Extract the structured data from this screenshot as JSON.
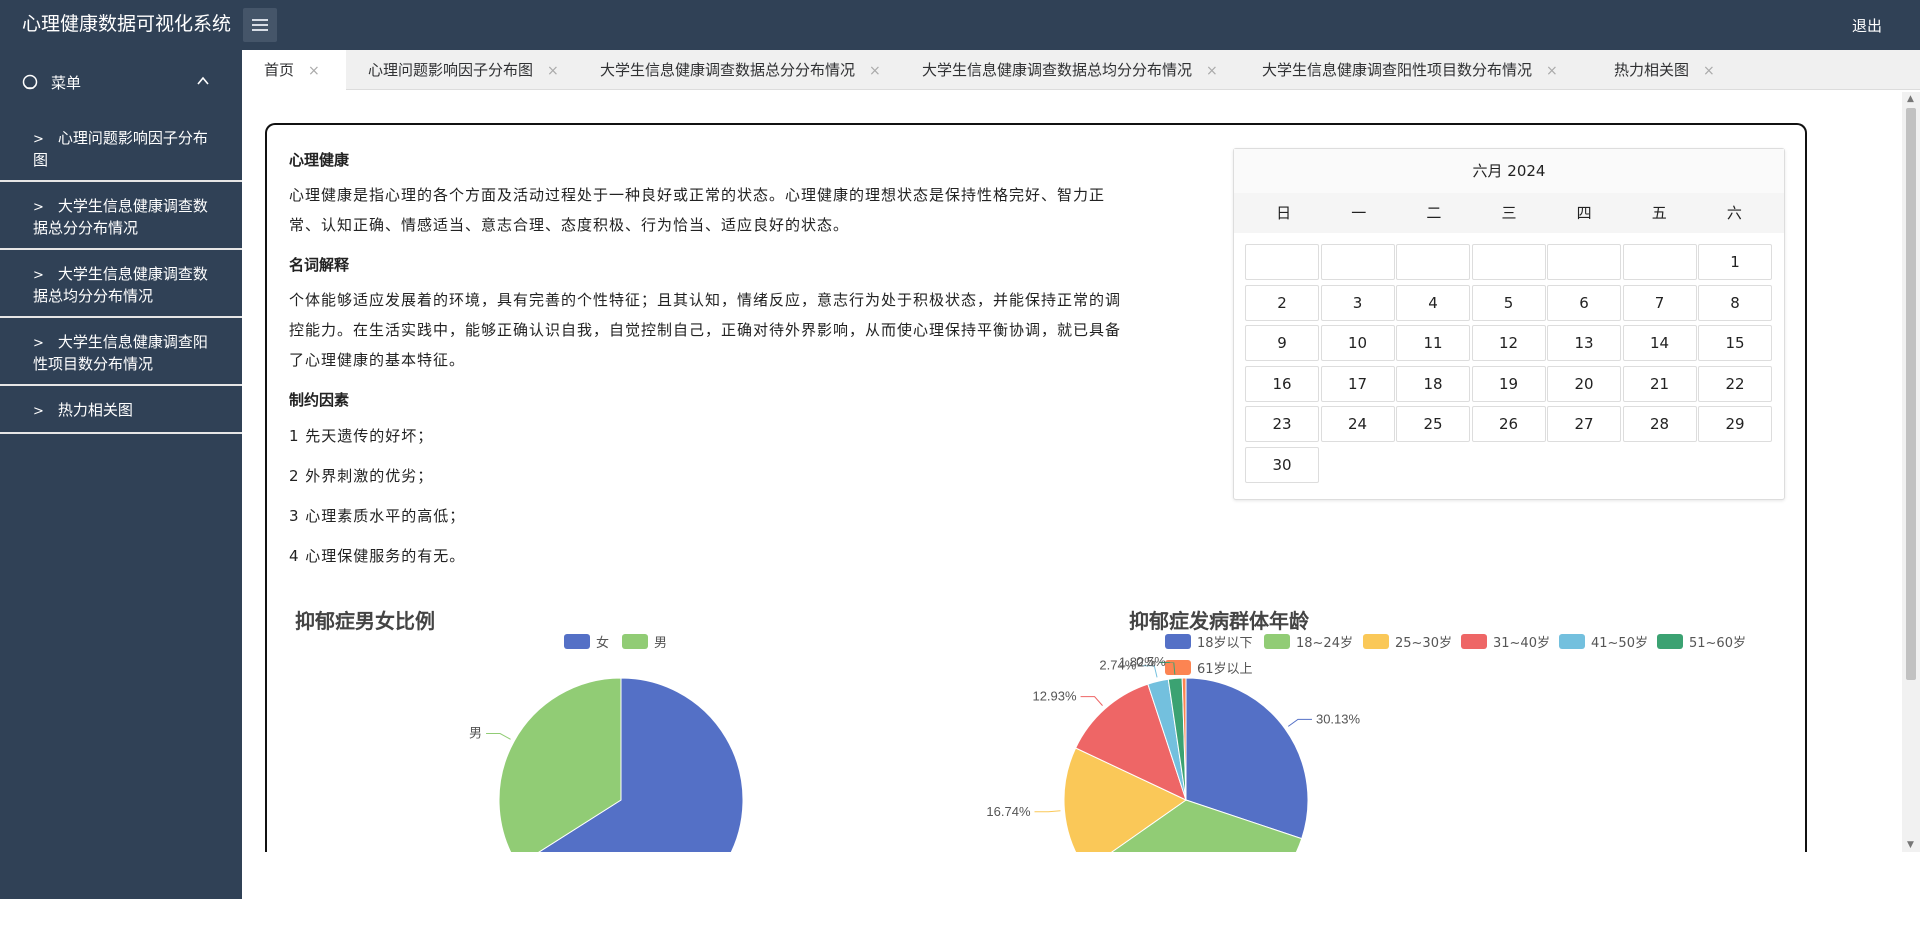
{
  "app": {
    "title": "心理健康数据可视化系统",
    "logout": "退出"
  },
  "sidebar": {
    "menu_label": "菜单",
    "items": [
      {
        "label": "心理问题影响因子分布图"
      },
      {
        "label": "大学生信息健康调查数据总分分布情况"
      },
      {
        "label": "大学生信息健康调查数据总均分分布情况"
      },
      {
        "label": "大学生信息健康调查阳性项目数分布情况"
      },
      {
        "label": "热力相关图"
      }
    ]
  },
  "tabs": [
    {
      "label": "首页"
    },
    {
      "label": "心理问题影响因子分布图"
    },
    {
      "label": "大学生信息健康调查数据总分分布情况"
    },
    {
      "label": "大学生信息健康调查数据总均分分布情况"
    },
    {
      "label": "大学生信息健康调查阳性项目数分布情况"
    },
    {
      "label": "热力相关图"
    }
  ],
  "tab_close": "×",
  "intro": {
    "h1": "心理健康",
    "p1": "心理健康是指心理的各个方面及活动过程处于一种良好或正常的状态。心理健康的理想状态是保持性格完好、智力正常、认知正确、情感适当、意志合理、态度积极、行为恰当、适应良好的状态。",
    "h2": "名词解释",
    "p2": "个体能够适应发展着的环境，具有完善的个性特征；且其认知，情绪反应，意志行为处于积极状态，并能保持正常的调控能力。在生活实践中，能够正确认识自我，自觉控制自己，正确对待外界影响，从而使心理保持平衡协调，就已具备了心理健康的基本特征。",
    "h3": "制约因素",
    "factors": [
      "1 先天遗传的好坏；",
      "2 外界刺激的优劣；",
      "3 心理素质水平的高低；",
      "4 心理保健服务的有无。"
    ]
  },
  "calendar": {
    "title": "六月 2024",
    "weekdays": [
      "日",
      "一",
      "二",
      "三",
      "四",
      "五",
      "六"
    ],
    "first_weekday": 6,
    "days": 30
  },
  "chart_data": [
    {
      "type": "pie",
      "title": "抑郁症男女比例",
      "series": [
        {
          "name": "女",
          "value": 66,
          "color": "#5470c6"
        },
        {
          "name": "男",
          "value": 34,
          "color": "#91cc75"
        }
      ],
      "legend_position": "top-center"
    },
    {
      "type": "pie",
      "title": "抑郁症发病群体年龄",
      "series": [
        {
          "name": "18岁以下",
          "value": 30.13,
          "label": "30.13%",
          "color": "#5470c6"
        },
        {
          "name": "18~24岁",
          "value": 35.14,
          "label": "",
          "color": "#91cc75"
        },
        {
          "name": "25~30岁",
          "value": 16.74,
          "label": "16.74%",
          "color": "#fac858"
        },
        {
          "name": "31~40岁",
          "value": 12.93,
          "label": "12.93%",
          "color": "#ee6666"
        },
        {
          "name": "41~50岁",
          "value": 2.74,
          "label": "2.74%",
          "color": "#73c0de"
        },
        {
          "name": "51~60岁",
          "value": 1.82,
          "label": "1.82%",
          "color": "#3ba272"
        },
        {
          "name": "61岁以上",
          "value": 0.5,
          "label": "0.5%",
          "color": "#fc8452"
        }
      ],
      "legend_position": "top-center"
    }
  ]
}
